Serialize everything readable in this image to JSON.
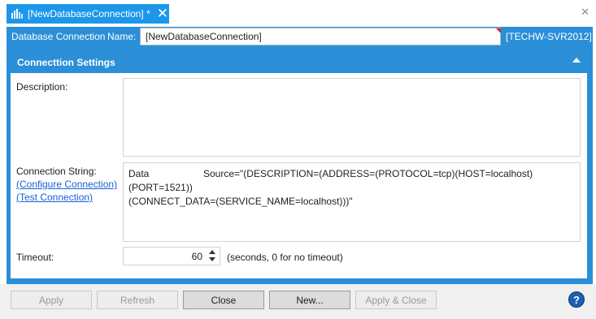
{
  "tab": {
    "title": "[NewDatabaseConnection] *",
    "icon": "database-connection-icon",
    "close_glyph": "✕"
  },
  "window": {
    "close_glyph": "✕"
  },
  "namebar": {
    "label_prefix": "Database Connection",
    "name_label": "Name:",
    "name_value": "[NewDatabaseConnection]",
    "server": "[TECHW-SVR2012]"
  },
  "section": {
    "title": "Connecttion Settings",
    "description_label": "Description:",
    "description_value": "",
    "connection_string_label": "Connection String:",
    "configure_link": "(Configure Connection)",
    "test_link": "(Test Connection)",
    "connection_string_word1": "Data",
    "connection_string_line1": "Source=\"(DESCRIPTION=(ADDRESS=(PROTOCOL=tcp)(HOST=localhost)(PORT=1521))",
    "connection_string_line2": "(CONNECT_DATA=(SERVICE_NAME=localhost)))\"",
    "timeout_label": "Timeout:",
    "timeout_value": "60",
    "timeout_note": "(seconds, 0 for no timeout)"
  },
  "buttons": {
    "apply": "Apply",
    "refresh": "Refresh",
    "close": "Close",
    "new": "New...",
    "apply_close": "Apply & Close",
    "help": "?"
  },
  "colors": {
    "accent": "#2b8fd8",
    "tab": "#1c97ea",
    "link": "#1660d3",
    "required_marker": "#e0211d"
  }
}
